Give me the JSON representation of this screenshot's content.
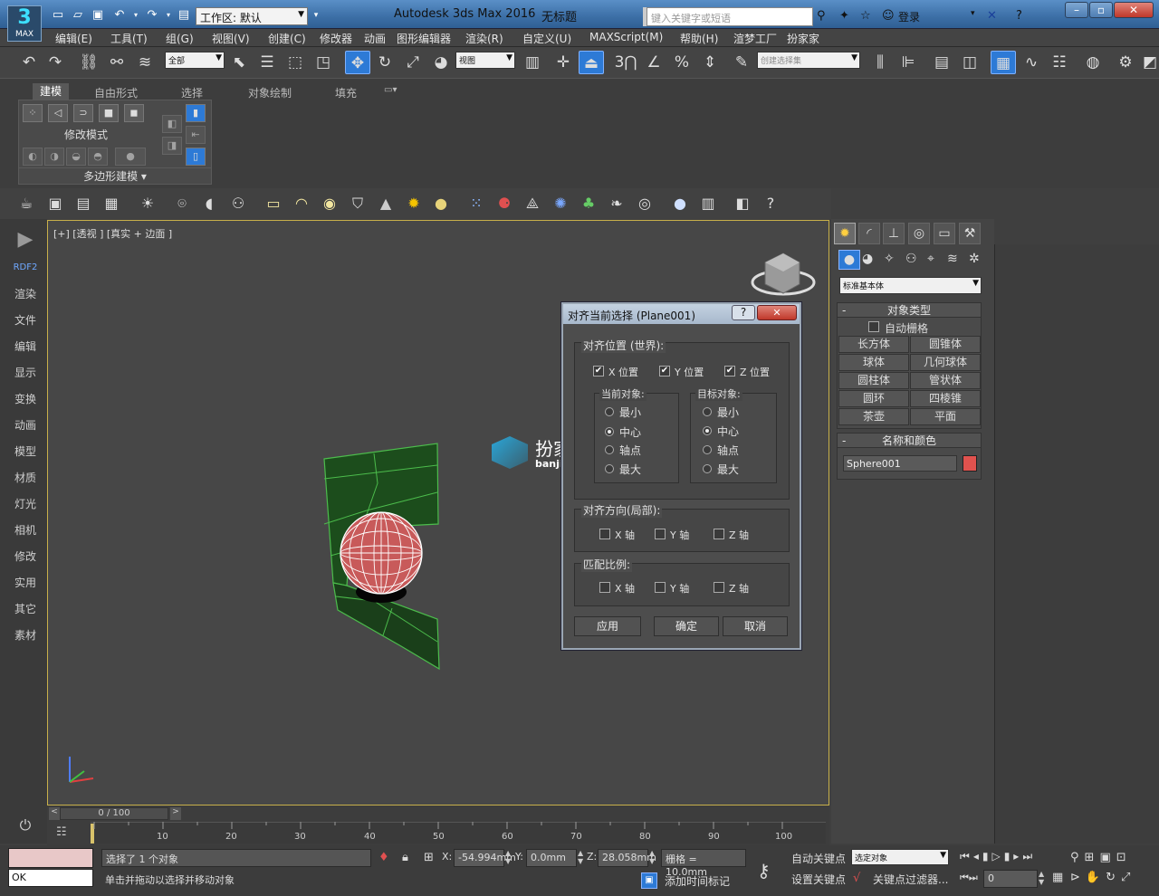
{
  "app": {
    "title": "Autodesk 3ds Max 2016",
    "document": "无标题",
    "logo_text": "MAX"
  },
  "quickaccess": {
    "workspace_label": "工作区: 默认"
  },
  "search": {
    "placeholder": "键入关键字或短语"
  },
  "login": {
    "label": "登录"
  },
  "menu": [
    "编辑(E)",
    "工具(T)",
    "组(G)",
    "视图(V)",
    "创建(C)",
    "修改器",
    "动画",
    "图形编辑器",
    "渲染(R)",
    "自定义(U)",
    "MAXScript(M)",
    "帮助(H)",
    "渲梦工厂",
    "扮家家"
  ],
  "toolbar": {
    "filter_value": "全部",
    "refcoord_value": "视图",
    "snap_3": "3",
    "selection_set_value": "创建选择集"
  },
  "ribbon": {
    "tabs": [
      "建模",
      "自由形式",
      "选择",
      "对象绘制",
      "填充"
    ],
    "active_tab": "建模",
    "modify_mode": "修改模式",
    "poly_modeling": "多边形建模"
  },
  "leftpanel": {
    "brand": "RDF2",
    "items": [
      "渲染",
      "文件",
      "编辑",
      "显示",
      "变换",
      "动画",
      "模型",
      "材质",
      "灯光",
      "相机",
      "修改",
      "实用",
      "其它",
      "素材"
    ]
  },
  "viewport": {
    "label": "[+] [透视 ] [真实 + 边面 ]"
  },
  "watermark": {
    "title": "扮家家室内设计",
    "url": "banjiajia.com"
  },
  "dialog": {
    "title": "对齐当前选择 (Plane001)",
    "help": "?",
    "close": "✕",
    "align_position_label": "对齐位置 (世界):",
    "x_pos": "X 位置",
    "y_pos": "Y 位置",
    "z_pos": "Z 位置",
    "x_checked": true,
    "y_checked": true,
    "z_checked": true,
    "current_object_label": "当前对象:",
    "target_object_label": "目标对象:",
    "current_options": [
      "最小",
      "中心",
      "轴点",
      "最大"
    ],
    "target_options": [
      "最小",
      "中心",
      "轴点",
      "最大"
    ],
    "current_selected": "中心",
    "target_selected": "中心",
    "orient_label": "对齐方向(局部):",
    "scale_label": "匹配比例:",
    "x_axis": "X 轴",
    "y_axis": "Y 轴",
    "z_axis": "Z 轴",
    "apply": "应用",
    "ok": "确定",
    "cancel": "取消"
  },
  "command_panel": {
    "category_value": "标准基本体",
    "object_type_title": "对象类型",
    "autogrid": "自动栅格",
    "buttons": [
      "长方体",
      "圆锥体",
      "球体",
      "几何球体",
      "圆柱体",
      "管状体",
      "圆环",
      "四棱锥",
      "茶壶",
      "平面"
    ],
    "name_color_title": "名称和颜色",
    "object_name": "Sphere001",
    "object_color": "#e0524e",
    "collapse": "-"
  },
  "timeline": {
    "frame_label": "0 / 100",
    "ticks": [
      "10",
      "20",
      "30",
      "40",
      "50",
      "60",
      "70",
      "80",
      "90",
      "100"
    ]
  },
  "status": {
    "maxscript_value": "OK",
    "selected_text": "选择了 1 个对象",
    "prompt_text": "单击并拖动以选择并移动对象",
    "x_label": "X:",
    "x_value": "-54.994mm",
    "y_label": "Y:",
    "y_value": "0.0mm",
    "z_label": "Z:",
    "z_value": "28.058mm",
    "grid_text": "栅格 = 10.0mm",
    "add_time_tag": "添加时间标记",
    "auto_key": "自动关键点",
    "set_key": "设置关键点",
    "selected_object": "选定对象",
    "key_filters": "关键点过滤器...",
    "frame_value": "0"
  },
  "colors": {
    "accent": "#2d7ad6",
    "sphere": "#c85a5a",
    "plane": "#1c4d1c",
    "viewport_border": "#c8b04a"
  }
}
